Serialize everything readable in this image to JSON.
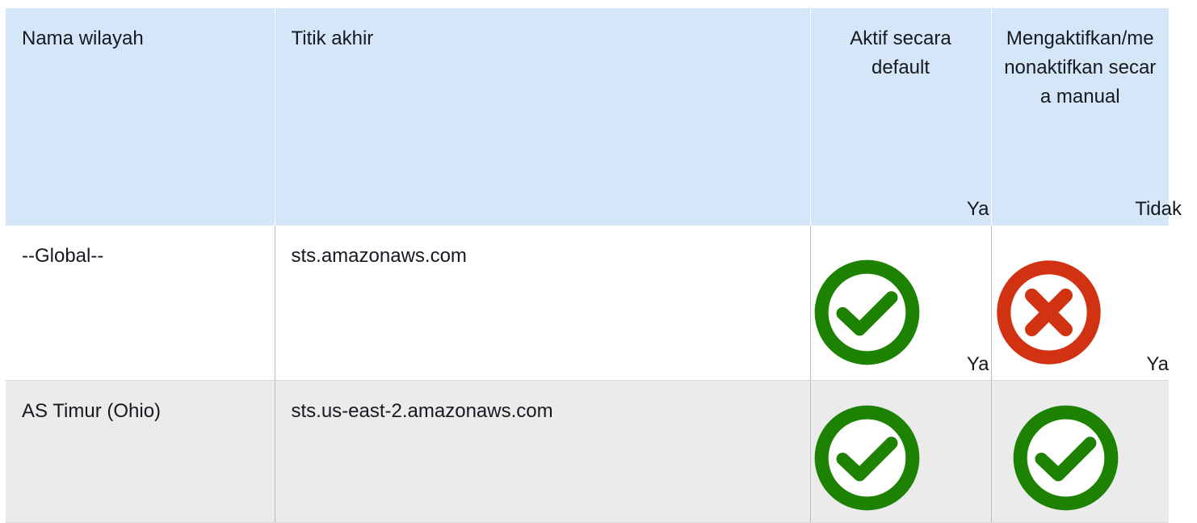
{
  "colors": {
    "header_bg": "#d4e6f7",
    "row_alt_bg": "#ebebec",
    "check_green": "#1d8102",
    "cross_red": "#d13212"
  },
  "table": {
    "headers": [
      "Nama wilayah",
      "Titik akhir",
      "Aktif secara default",
      "Mengaktifkan/menonaktifkan secara manual"
    ],
    "rows": [
      {
        "region": "--Global--",
        "endpoint": "sts.amazonaws.com",
        "default_active": {
          "icon": "check-circle-icon",
          "label": "Ya"
        },
        "manual_toggle": {
          "icon": "cross-circle-icon",
          "label": "Tidak"
        }
      },
      {
        "region": "AS Timur (Ohio)",
        "endpoint": "sts.us-east-2.amazonaws.com",
        "default_active": {
          "icon": "check-circle-icon",
          "label": "Ya"
        },
        "manual_toggle": {
          "icon": "check-circle-icon",
          "label": "Ya"
        }
      }
    ]
  }
}
